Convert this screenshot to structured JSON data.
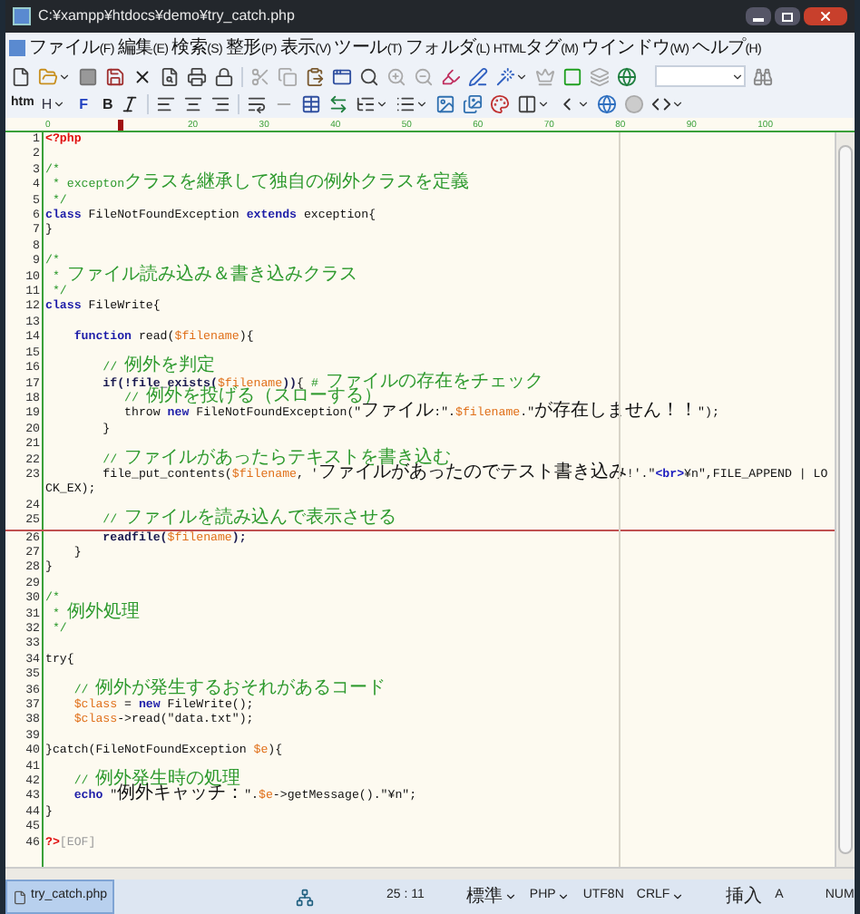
{
  "window": {
    "title": "C:¥xampp¥htdocs¥demo¥try_catch.php"
  },
  "menu": [
    "ファイル(F)",
    "編集(E)",
    "検索(S)",
    "整形(P)",
    "表示(V)",
    "ツール(T)",
    "フォルダ(L)",
    "HTMLタグ(M)",
    "ウインドウ(W)",
    "ヘルプ(H)"
  ],
  "toolbar2_labels": [
    "htm",
    "H",
    "F",
    "B"
  ],
  "ruler": {
    "labels": [
      "0",
      "20",
      "30",
      "40",
      "50",
      "60",
      "70",
      "80",
      "90",
      "100"
    ]
  },
  "lines": [
    {
      "n": "1",
      "cursor": false,
      "tokens": [
        {
          "kind": "tag",
          "text": "<?php"
        }
      ]
    },
    {
      "n": "2",
      "cursor": false
    },
    {
      "n": "3",
      "cursor": false,
      "tokens": [
        {
          "kind": "comment",
          "text": "/*"
        }
      ]
    },
    {
      "n": "4",
      "cursor": false,
      "tokens": [
        {
          "kind": "comment",
          "text": " * exceptonクラスを継承して独自の例外クラスを定義"
        }
      ]
    },
    {
      "n": "5",
      "cursor": false,
      "tokens": [
        {
          "kind": "comment",
          "text": " */"
        }
      ]
    },
    {
      "n": "6",
      "cursor": false,
      "tokens": [
        {
          "kind": "keyword",
          "text": "class"
        },
        {
          "kind": "plain",
          "text": " FileNotFoundException "
        },
        {
          "kind": "keyword",
          "text": "extends"
        },
        {
          "kind": "plain",
          "text": " exception{"
        }
      ]
    },
    {
      "n": "7",
      "cursor": false,
      "tokens": [
        {
          "kind": "plain",
          "text": "}"
        }
      ]
    },
    {
      "n": "8",
      "cursor": false
    },
    {
      "n": "9",
      "cursor": false,
      "tokens": [
        {
          "kind": "comment",
          "text": "/*"
        }
      ]
    },
    {
      "n": "10",
      "cursor": false,
      "tokens": [
        {
          "kind": "comment",
          "text": " * ファイル読み込み＆書き込みクラス"
        }
      ]
    },
    {
      "n": "11",
      "cursor": false,
      "tokens": [
        {
          "kind": "comment",
          "text": " */"
        }
      ]
    },
    {
      "n": "12",
      "cursor": false,
      "tokens": [
        {
          "kind": "keyword",
          "text": "class"
        },
        {
          "kind": "plain",
          "text": " FileWrite{"
        }
      ]
    },
    {
      "n": "13",
      "cursor": false
    },
    {
      "n": "14",
      "cursor": false,
      "tokens": [
        {
          "kind": "keyword",
          "text": "    function"
        },
        {
          "kind": "plain",
          "text": " read("
        },
        {
          "kind": "var",
          "text": "$filename"
        },
        {
          "kind": "plain",
          "text": "){"
        }
      ]
    },
    {
      "n": "15",
      "cursor": false
    },
    {
      "n": "16",
      "cursor": false,
      "tokens": [
        {
          "kind": "comment",
          "text": "        // 例外を判定"
        }
      ]
    },
    {
      "n": "17",
      "cursor": false,
      "tokens": [
        {
          "kind": "fn",
          "text": "        if(!file_exists("
        },
        {
          "kind": "var",
          "text": "$filename"
        },
        {
          "kind": "fn",
          "text": "))"
        },
        {
          "kind": "plain",
          "text": "{ "
        },
        {
          "kind": "comment",
          "text": "# ファイルの存在をチェック"
        }
      ]
    },
    {
      "n": "18",
      "cursor": false,
      "tokens": [
        {
          "kind": "comment",
          "text": "           // 例外を投げる（スローする）"
        }
      ]
    },
    {
      "n": "19",
      "cursor": false,
      "tokens": [
        {
          "kind": "plain",
          "text": "           throw "
        },
        {
          "kind": "keyword",
          "text": "new"
        },
        {
          "kind": "plain",
          "text": " FileNotFoundException(\"ファイル:\"."
        },
        {
          "kind": "var",
          "text": "$filename"
        },
        {
          "kind": "plain",
          "text": ".\"が存在しません！！\");"
        }
      ]
    },
    {
      "n": "20",
      "cursor": false,
      "tokens": [
        {
          "kind": "plain",
          "text": "        }"
        }
      ]
    },
    {
      "n": "21",
      "cursor": false
    },
    {
      "n": "22",
      "cursor": false,
      "tokens": [
        {
          "kind": "comment",
          "text": "        // ファイルがあったらテキストを書き込む"
        }
      ]
    },
    {
      "n": "23",
      "cursor": false,
      "tokens": [
        {
          "kind": "plain",
          "text": "        file_put_contents("
        },
        {
          "kind": "var",
          "text": "$filename"
        },
        {
          "kind": "plain",
          "text": ", 'ファイルがあったのでテスト書き込み!'.\""
        },
        {
          "kind": "html",
          "text": "<br>"
        },
        {
          "kind": "plain",
          "text": "¥n\",FILE_APPEND | LOCK_EX);"
        }
      ]
    },
    {
      "n": "24",
      "cursor": false
    },
    {
      "n": "25",
      "cursor": true,
      "tokens": [
        {
          "kind": "comment",
          "text": "        // ファイルを読み込んで表示させる"
        }
      ]
    },
    {
      "n": "26",
      "cursor": false,
      "tokens": [
        {
          "kind": "fn",
          "text": "        readfile("
        },
        {
          "kind": "var",
          "text": "$filename"
        },
        {
          "kind": "fn",
          "text": ");"
        }
      ]
    },
    {
      "n": "27",
      "cursor": false,
      "tokens": [
        {
          "kind": "plain",
          "text": "    }"
        }
      ]
    },
    {
      "n": "28",
      "cursor": false,
      "tokens": [
        {
          "kind": "plain",
          "text": "}"
        }
      ]
    },
    {
      "n": "29",
      "cursor": false
    },
    {
      "n": "30",
      "cursor": false,
      "tokens": [
        {
          "kind": "comment",
          "text": "/*"
        }
      ]
    },
    {
      "n": "31",
      "cursor": false,
      "tokens": [
        {
          "kind": "comment",
          "text": " * 例外処理"
        }
      ]
    },
    {
      "n": "32",
      "cursor": false,
      "tokens": [
        {
          "kind": "comment",
          "text": " */"
        }
      ]
    },
    {
      "n": "33",
      "cursor": false
    },
    {
      "n": "34",
      "cursor": false,
      "tokens": [
        {
          "kind": "plain",
          "text": "try{"
        }
      ]
    },
    {
      "n": "35",
      "cursor": false
    },
    {
      "n": "36",
      "cursor": false,
      "tokens": [
        {
          "kind": "comment",
          "text": "    // 例外が発生するおそれがあるコード"
        }
      ]
    },
    {
      "n": "37",
      "cursor": false,
      "tokens": [
        {
          "kind": "var",
          "text": "    $class"
        },
        {
          "kind": "plain",
          "text": " = "
        },
        {
          "kind": "keyword",
          "text": "new"
        },
        {
          "kind": "plain",
          "text": " FileWrite();"
        }
      ]
    },
    {
      "n": "38",
      "cursor": false,
      "tokens": [
        {
          "kind": "var",
          "text": "    $class"
        },
        {
          "kind": "plain",
          "text": "->read(\"data.txt\");"
        }
      ]
    },
    {
      "n": "39",
      "cursor": false
    },
    {
      "n": "40",
      "cursor": false,
      "tokens": [
        {
          "kind": "plain",
          "text": "}catch(FileNotFoundException "
        },
        {
          "kind": "var",
          "text": "$e"
        },
        {
          "kind": "plain",
          "text": "){"
        }
      ]
    },
    {
      "n": "41",
      "cursor": false
    },
    {
      "n": "42",
      "cursor": false,
      "tokens": [
        {
          "kind": "comment",
          "text": "    // 例外発生時の処理"
        }
      ]
    },
    {
      "n": "43",
      "cursor": false,
      "tokens": [
        {
          "kind": "keyword",
          "text": "    echo"
        },
        {
          "kind": "plain",
          "text": " \"例外キャッチ：\"."
        },
        {
          "kind": "var",
          "text": "$e"
        },
        {
          "kind": "plain",
          "text": "->getMessage().\"¥n\";"
        }
      ]
    },
    {
      "n": "44",
      "cursor": false,
      "tokens": [
        {
          "kind": "plain",
          "text": "}"
        }
      ]
    },
    {
      "n": "45",
      "cursor": false
    },
    {
      "n": "46",
      "cursor": false,
      "tokens": [
        {
          "kind": "tag",
          "text": "?>"
        },
        {
          "kind": "eof",
          "text": "[EOF]"
        }
      ]
    }
  ],
  "tabs": [
    {
      "label": "try_catch.php",
      "selected": true
    }
  ],
  "status_bar": [
    {
      "kind": "plain",
      "text": "25 : 11"
    },
    {
      "kind": "menu",
      "text": "標準"
    },
    {
      "kind": "menu",
      "text": "PHP"
    },
    {
      "kind": "plain",
      "text": "UTF8N"
    },
    {
      "kind": "menu",
      "text": "CRLF"
    },
    {
      "kind": "plain",
      "text": "挿入"
    },
    {
      "kind": "plain",
      "text": "A"
    },
    {
      "kind": "plain",
      "text": "NUM"
    }
  ]
}
